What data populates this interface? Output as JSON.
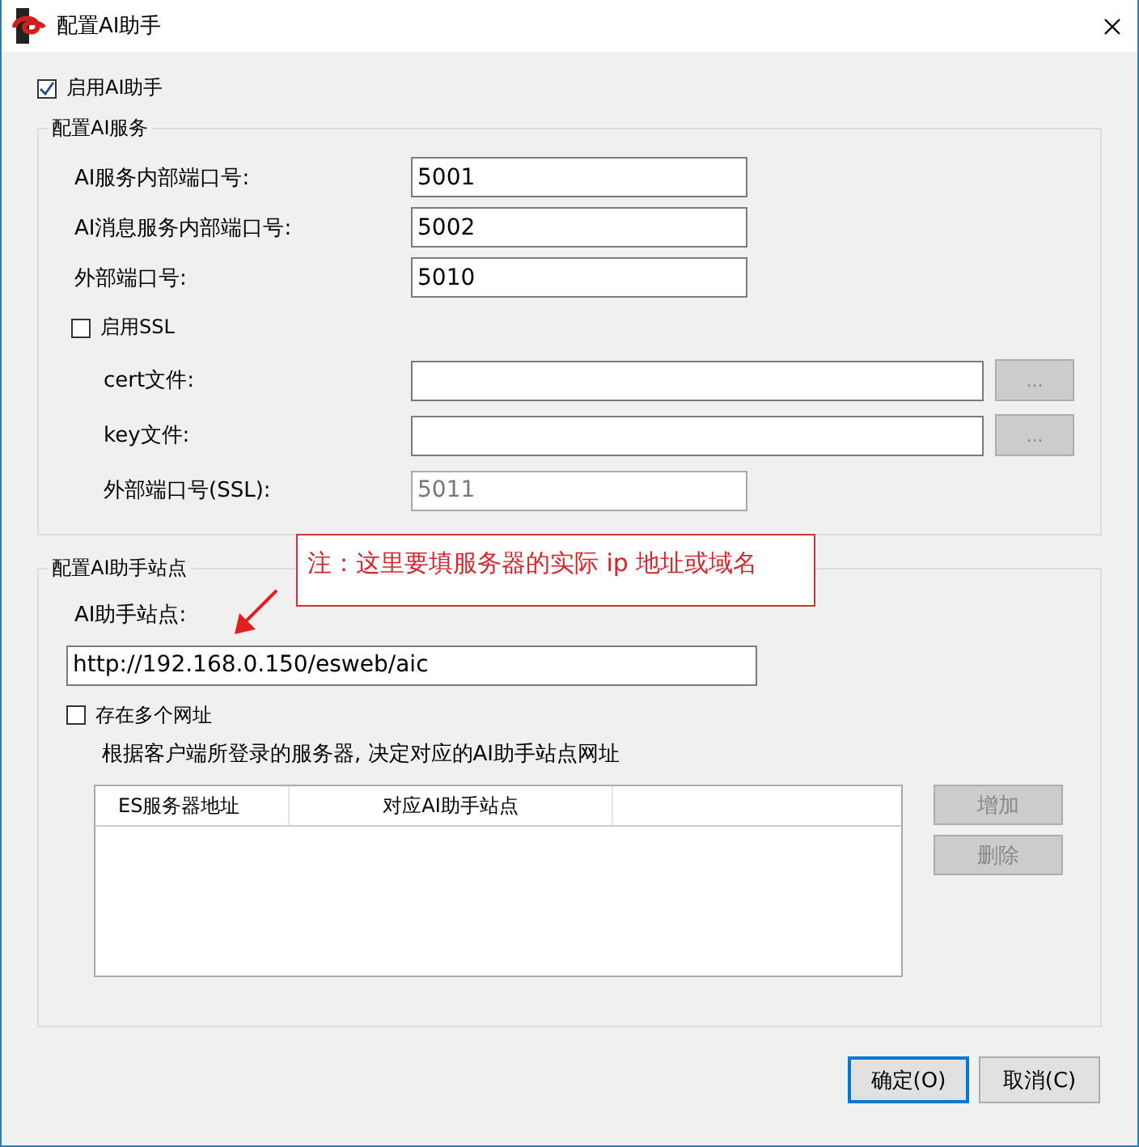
{
  "window": {
    "title": "配置AI助手"
  },
  "enable_ai": {
    "label": "启用AI助手",
    "checked": true
  },
  "service_group": {
    "title": "配置AI服务",
    "fields": [
      {
        "label": "AI服务内部端口号:",
        "value": "5001"
      },
      {
        "label": "AI消息服务内部端口号:",
        "value": "5002"
      },
      {
        "label": "外部端口号:",
        "value": "5010"
      }
    ],
    "ssl": {
      "label": "启用SSL",
      "checked": false
    },
    "ssl_files": [
      {
        "label": "cert文件:",
        "browse": "..."
      },
      {
        "label": "key文件:",
        "browse": "..."
      }
    ],
    "ssl_port": {
      "label": "外部端口号(SSL):",
      "value": "5011",
      "disabled": true
    }
  },
  "annotation": {
    "text": "注：这里要填服务器的实际 ip 地址或域名"
  },
  "site_group": {
    "title": "配置AI助手站点",
    "site_label": "AI助手站点:",
    "site_value": "http://192.168.0.150/esweb/aic",
    "multiple": {
      "label": "存在多个网址",
      "checked": false
    },
    "description": "根据客户端所登录的服务器, 决定对应的AI助手站点网址",
    "table": {
      "columns": [
        "ES服务器地址",
        "对应AI助手站点"
      ]
    },
    "side_buttons": [
      {
        "label": "增加",
        "disabled": true
      },
      {
        "label": "删除",
        "disabled": true
      }
    ]
  },
  "buttons": [
    {
      "label": "确定(O)",
      "default": true
    },
    {
      "label": "取消(C)",
      "default": false
    }
  ]
}
